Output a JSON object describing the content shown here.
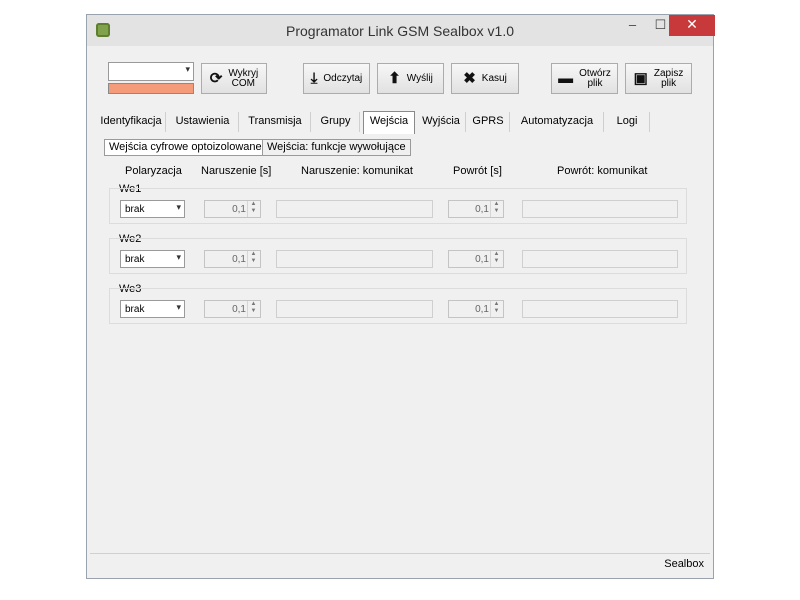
{
  "window": {
    "title": "Programator Link GSM Sealbox v1.0",
    "minimize": "–",
    "maximize": "☐",
    "close": "✕"
  },
  "toolbar": {
    "com_select_value": "",
    "detect_com_label": "Wykryj\nCOM",
    "read_label": "Odczytaj",
    "send_label": "Wyślij",
    "clear_label": "Kasuj",
    "open_file_label": "Otwórz\nplik",
    "save_file_label": "Zapisz\nplik",
    "port_status_color": "#f49b7a"
  },
  "tabs": [
    "Identyfikacja",
    "Ustawienia",
    "Transmisja",
    "Grupy",
    "Wejścia",
    "Wyjścia",
    "GPRS",
    "Automatyzacja",
    "Logi"
  ],
  "active_tab": "Wejścia",
  "subtabs": [
    "Wejścia cyfrowe optoizolowane",
    "Wejścia: funkcje wywołujące"
  ],
  "columns": {
    "polarization": "Polaryzacja",
    "violation": "Naruszenie [s]",
    "violation_msg": "Naruszenie: komunikat",
    "restore": "Powrót [s]",
    "restore_msg": "Powrót: komunikat"
  },
  "inputs": [
    {
      "name": "We1",
      "polarization": "brak",
      "violation": "0,1",
      "violation_msg": "",
      "restore": "0,1",
      "restore_msg": ""
    },
    {
      "name": "We2",
      "polarization": "brak",
      "violation": "0,1",
      "violation_msg": "",
      "restore": "0,1",
      "restore_msg": ""
    },
    {
      "name": "We3",
      "polarization": "brak",
      "violation": "0,1",
      "violation_msg": "",
      "restore": "0,1",
      "restore_msg": ""
    }
  ],
  "status": {
    "text": "Sealbox"
  },
  "icons": {
    "refresh": "⟳",
    "download": "⤓",
    "upload": "⬆",
    "clear": "✖",
    "folder": "▬",
    "save": "▣",
    "chevron": "▾"
  }
}
